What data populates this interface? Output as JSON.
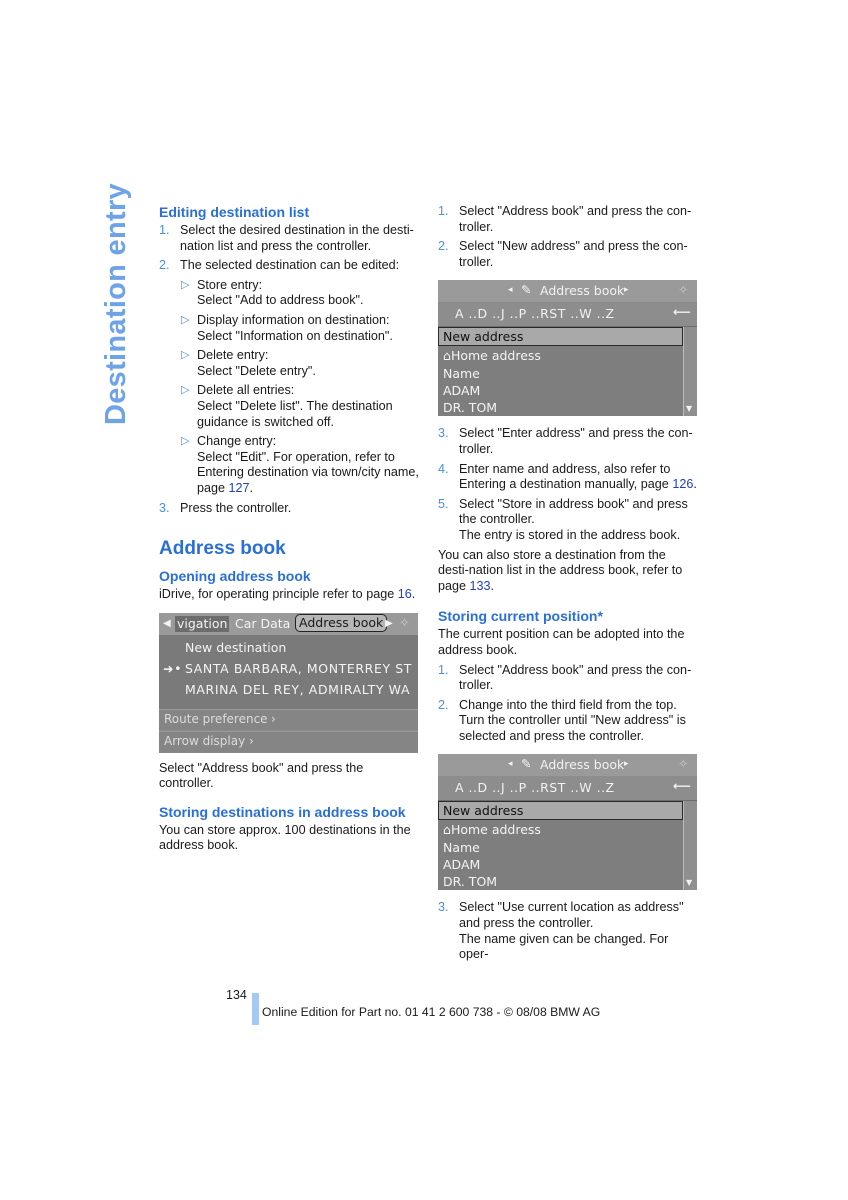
{
  "side_title": "Destination entry",
  "left": {
    "editing": {
      "heading": "Editing destination list",
      "steps": [
        {
          "num": "1.",
          "text": "Select the desired destination in the desti-nation list and press the controller."
        },
        {
          "num": "2.",
          "text": "The selected destination can be edited:"
        },
        {
          "num": "3.",
          "text": "Press the controller."
        }
      ],
      "bullets": [
        {
          "title": "Store entry:",
          "text": "Select \"Add to address book\"."
        },
        {
          "title": "Display information on destination:",
          "text": "Select \"Information on destination\"."
        },
        {
          "title": "Delete entry:",
          "text": "Select \"Delete entry\"."
        },
        {
          "title": "Delete all entries:",
          "text": "Select \"Delete list\". The destination guidance is switched off."
        },
        {
          "title": "Change entry:",
          "text": "Select \"Edit\". For operation, refer to Entering destination via town/city name, page ",
          "link": "127",
          "after": "."
        }
      ]
    },
    "address_book_heading": "Address book",
    "opening": {
      "heading": "Opening address book",
      "text": "iDrive, for operating principle refer to page ",
      "link": "16",
      "after": "."
    },
    "screen": {
      "tabs": [
        "vigation",
        "Car Data",
        "Address book"
      ],
      "rows": [
        "New destination",
        "SANTA BARBARA, MONTERREY ST",
        "MARINA DEL REY, ADMIRALTY WA"
      ],
      "options": [
        "Route preference",
        "Arrow display"
      ]
    },
    "after_screen": "Select \"Address book\" and press the controller.",
    "storing": {
      "heading": "Storing destinations in address book",
      "text": "You can store approx. 100 destinations in the address book."
    }
  },
  "right": {
    "steps_a": [
      {
        "num": "1.",
        "text": "Select \"Address book\" and press the con-troller."
      },
      {
        "num": "2.",
        "text": "Select \"New address\" and press the con-troller."
      }
    ],
    "screen": {
      "title": "Address book",
      "alpha": "A ..D ..J ..P ..RST ..W ..Z",
      "items": [
        "New address",
        "Home address",
        "Name",
        "ADAM",
        "DR. TOM"
      ]
    },
    "steps_b": [
      {
        "num": "3.",
        "text": "Select \"Enter address\" and press the con-troller."
      },
      {
        "num": "4.",
        "text": "Enter name and address, also refer to Entering a destination manually, page ",
        "link": "126",
        "after": "."
      },
      {
        "num": "5.",
        "text": "Select \"Store in address book\" and press the controller.",
        "extra": "The entry is stored in the address book."
      }
    ],
    "also_text": "You can also store a destination from the desti-nation list in the address book, refer to page ",
    "also_link": "133",
    "also_after": ".",
    "current": {
      "heading": "Storing current position*",
      "text": "The current position can be adopted into the address book.",
      "steps": [
        {
          "num": "1.",
          "text": "Select \"Address book\" and press the con-troller."
        },
        {
          "num": "2.",
          "text": "Change into the third field from the top. Turn the controller until \"New address\" is selected and press the controller."
        }
      ],
      "step3": {
        "num": "3.",
        "text": "Select \"Use current location as address\" and press the controller.",
        "extra": "The name given can be changed. For oper-"
      }
    }
  },
  "footer": {
    "page_number": "134",
    "edition": "Online Edition for Part no. 01 41 2 600 738 - © 08/08 BMW AG"
  },
  "colors": {
    "heading": "#2a6fd6",
    "side_title": "#6fa3e8",
    "link": "#1f3fb8",
    "footer_bar": "#a7c8f5"
  }
}
